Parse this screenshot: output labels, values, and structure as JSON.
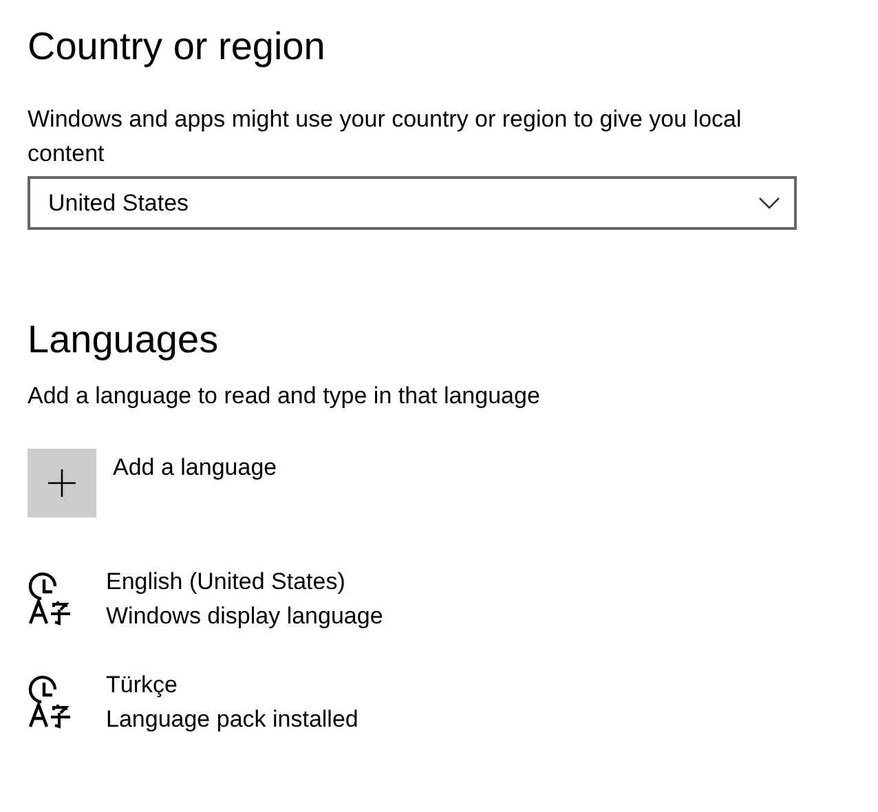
{
  "country_section": {
    "title": "Country or region",
    "description": "Windows and apps might use your country or region to give you local content",
    "dropdown": {
      "value": "United States"
    }
  },
  "languages_section": {
    "title": "Languages",
    "description": "Add a language to read and type in that language",
    "add_button": {
      "label": "Add a language"
    },
    "languages": [
      {
        "name": "English (United States)",
        "status": "Windows display language"
      },
      {
        "name": "Türkçe",
        "status": "Language pack installed"
      }
    ]
  }
}
